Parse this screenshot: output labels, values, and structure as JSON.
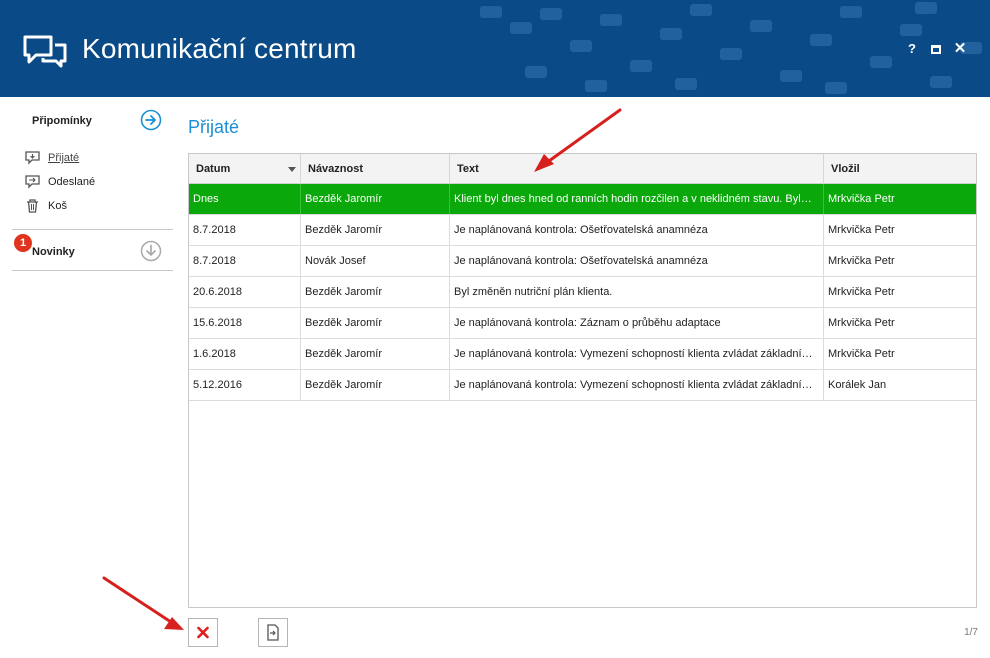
{
  "app": {
    "title": "Komunikační centrum",
    "icon": "chat-bubbles-icon"
  },
  "window_controls": {
    "help": "?",
    "maximize_icon": "maximize-icon",
    "close": "✕"
  },
  "sidebar": {
    "section_title": "Připomínky",
    "items": [
      {
        "label": "Přijaté",
        "icon": "inbox-icon",
        "active": true
      },
      {
        "label": "Odeslané",
        "icon": "outbox-icon",
        "active": false
      },
      {
        "label": "Koš",
        "icon": "trash-icon",
        "active": false
      }
    ],
    "news": {
      "label": "Novinky",
      "badge": "1"
    }
  },
  "main": {
    "title": "Přijaté",
    "columns": [
      "Datum",
      "Návaznost",
      "Text",
      "Vložil"
    ],
    "rows": [
      {
        "datum": "Dnes",
        "navaznost": "Bezděk Jaromír",
        "text": "Klient byl dnes hned od ranních hodin rozčilen a v neklidném stavu. Byl…",
        "vlozil": "Mrkvička Petr",
        "selected": true
      },
      {
        "datum": "8.7.2018",
        "navaznost": "Bezděk Jaromír",
        "text": "Je naplánovaná kontrola: Ošetřovatelská anamnéza",
        "vlozil": "Mrkvička Petr",
        "selected": false
      },
      {
        "datum": "8.7.2018",
        "navaznost": "Novák Josef",
        "text": "Je naplánovaná kontrola: Ošetřovatelská anamnéza",
        "vlozil": "Mrkvička Petr",
        "selected": false
      },
      {
        "datum": "20.6.2018",
        "navaznost": "Bezděk Jaromír",
        "text": "Byl změněn nutriční plán klienta.",
        "vlozil": "Mrkvička Petr",
        "selected": false
      },
      {
        "datum": "15.6.2018",
        "navaznost": "Bezděk Jaromír",
        "text": "Je naplánovaná kontrola: Záznam o průběhu adaptace",
        "vlozil": "Mrkvička Petr",
        "selected": false
      },
      {
        "datum": "1.6.2018",
        "navaznost": "Bezděk Jaromír",
        "text": "Je naplánovaná kontrola: Vymezení schopností klienta zvládat základní…",
        "vlozil": "Mrkvička Petr",
        "selected": false
      },
      {
        "datum": "5.12.2016",
        "navaznost": "Bezděk Jaromír",
        "text": "Je naplánovaná kontrola: Vymezení schopností klienta zvládat základní…",
        "vlozil": "Korálek Jan",
        "selected": false
      }
    ],
    "pager": "1/7"
  },
  "toolbar": {
    "delete_icon": "delete-x-icon",
    "export_icon": "export-document-icon"
  },
  "colors": {
    "header": "#0a4a86",
    "accent": "#1b8fd6",
    "selected_row": "#0aa80a",
    "badge": "#e0341f",
    "annotation_arrow": "#d6201e"
  }
}
